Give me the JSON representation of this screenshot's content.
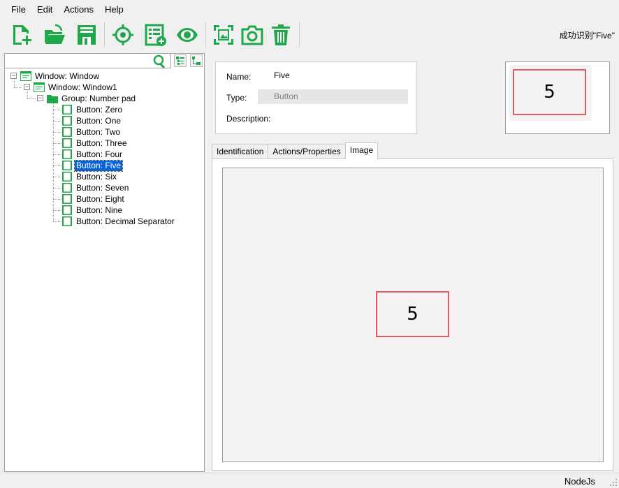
{
  "menu": [
    "File",
    "Edit",
    "Actions",
    "Help"
  ],
  "toolbar": {
    "buttons": [
      "new-model",
      "open-model",
      "save-model",
      "spy-object",
      "add-objects",
      "highlight-object",
      "capture-screenshot",
      "camera-snapshot",
      "delete-object"
    ],
    "status_message": "成功识别\"Five\""
  },
  "search": {
    "value": ""
  },
  "tree": {
    "window": "Window: Window",
    "window1": "Window: Window1",
    "group": "Group: Number pad",
    "buttons": [
      "Button: Zero",
      "Button: One",
      "Button: Two",
      "Button: Three",
      "Button: Four",
      "Button: Five",
      "Button: Six",
      "Button: Seven",
      "Button: Eight",
      "Button: Nine",
      "Button: Decimal Separator"
    ],
    "selected": "Button: Five"
  },
  "details": {
    "name_label": "Name:",
    "name_value": "Five",
    "type_label": "Type:",
    "type_value": "Button",
    "description_label": "Description:",
    "description_value": ""
  },
  "thumbnail": {
    "text": "5"
  },
  "tabs": [
    "Identification",
    "Actions/Properties",
    "Image"
  ],
  "active_tab": "Image",
  "image_preview": {
    "text": "5"
  },
  "statusbar": {
    "engine": "NodeJs"
  },
  "colors": {
    "accent_green": "#1ea84a",
    "highlight_red": "#e15a5a",
    "selection_blue": "#0a64d8"
  }
}
